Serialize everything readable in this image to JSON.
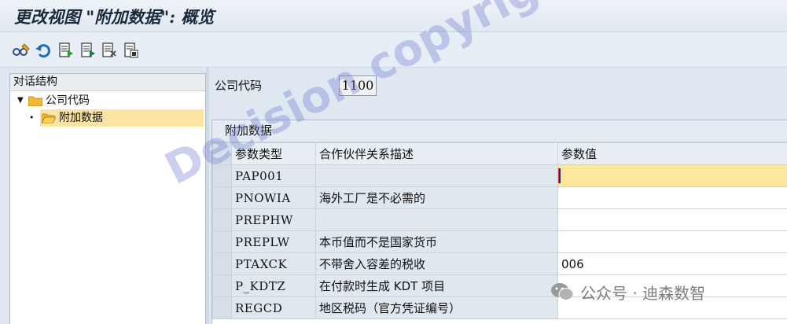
{
  "window": {
    "title": "更改视图 \"附加数据\": 概览"
  },
  "toolbar": {
    "icons": [
      "display-change-icon",
      "undo-icon",
      "new-entries-icon",
      "copy-as-icon",
      "delete-icon",
      "select-all-icon"
    ]
  },
  "dialog_structure": {
    "header": "对话结构",
    "nodes": [
      {
        "label": "公司代码",
        "expanded": true,
        "selected": false
      },
      {
        "label": "附加数据",
        "selected": true
      }
    ]
  },
  "company": {
    "label": "公司代码",
    "value": "1100"
  },
  "additional_data": {
    "section_title": "附加数据",
    "columns": [
      "参数类型",
      "合作伙伴关系描述",
      "参数值"
    ],
    "rows": [
      {
        "code": "PAP001",
        "desc": "",
        "value": ""
      },
      {
        "code": "PNOWIA",
        "desc": "海外工厂是不必需的",
        "value": ""
      },
      {
        "code": "PREPHW",
        "desc": "",
        "value": ""
      },
      {
        "code": "PREPLW",
        "desc": "本币值而不是国家货币",
        "value": ""
      },
      {
        "code": "PTAXCK",
        "desc": "不带舍入容差的税收",
        "value": "006"
      },
      {
        "code": "P_KDTZ",
        "desc": "在付款时生成 KDT 项目",
        "value": ""
      },
      {
        "code": "REGCD",
        "desc": "地区税码（官方凭证编号）",
        "value": ""
      }
    ]
  },
  "watermark": {
    "text": "Decision copyright"
  },
  "wechat_caption": {
    "text": "公众号 · 迪森数智"
  },
  "colors": {
    "selected_row": "#fbe3a4",
    "focused_cell": "#fce79c",
    "folder": "#f1b92e"
  }
}
